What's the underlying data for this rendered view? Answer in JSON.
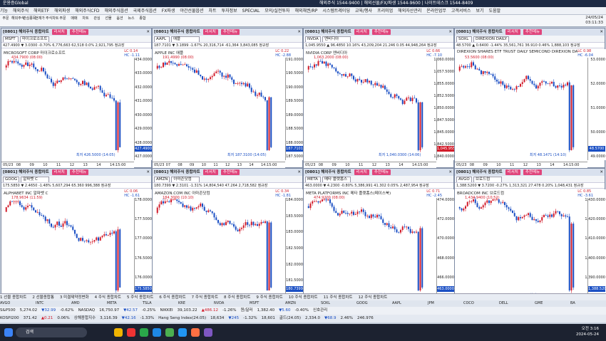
{
  "titlebar": {
    "app": "운용증Global",
    "phones": "해외주식 1544-9400 | 해외선물/FX/파생 1544-9600 | 나이트데스크 1544-8409"
  },
  "menu": [
    "기능",
    "해외주식",
    "해외ETF",
    "해외파생",
    "해외주식CFD",
    "해외주식옵션",
    "국제주식옵션",
    "FX파생",
    "야간선물옵션",
    "차트",
    "투자정보",
    "SPECIAL",
    "모의/실전투자",
    "해외채권/RP",
    "시스템트레이딩",
    "교육/행사",
    "프리미엄",
    "해외자산관리",
    "온라인업무",
    "고객서비스",
    "보기",
    "도움말"
  ],
  "toolbar": [
    "주문",
    "해외주식",
    "관심종목",
    "현재가",
    "주식차트",
    "주문",
    "매매",
    "차트",
    "관심",
    "선물",
    "옵션",
    "뉴스",
    "종합"
  ],
  "datetime": {
    "date": "24/05/24",
    "time": "03:11:33"
  },
  "panels": [
    {
      "code": "[0801] 해외주식 종합차트",
      "btn1": "리서치",
      "btn2": "추천메뉴",
      "sym": "MSFT",
      "name": "마이크로소프트",
      "r3": "427.4900 ▼ 3.0300 -0.70% 6,776,663 62,518 0.0% 2,921,795 정규장",
      "title": "MICROSOFT CORP 마이크로소프트",
      "lc": "LC 0.14",
      "hc": "HC -1.11",
      "max": "434.7900 (08:00)",
      "min": "최저 426.5000 (14:05)",
      "cur": "427.4900",
      "y": [
        "434.0000",
        "433.0000",
        "432.0000",
        "431.0000",
        "430.0000",
        "429.0000",
        "428.0000",
        "427.0000"
      ],
      "x": [
        "05/23",
        "08",
        "09",
        "10",
        "11",
        "12",
        "13",
        "14",
        "14:15:00"
      ],
      "color": "#1a4fc4"
    },
    {
      "code": "[0801] 해외주식 종합차트",
      "btn1": "리서치",
      "btn2": "추천메뉴",
      "sym": "AAPL",
      "name": "애플",
      "r3": "187.7101 ▼ 3.1899 -1.67% 20,316,714 -61,364 3,843,085 정규장",
      "title": "APPLE INC 애플",
      "lc": "LC 0.22",
      "hc": "HC -2.88",
      "max": "191.4990 (08:00)",
      "min": "최저 187.3100 (14:05)",
      "cur": "187.7101",
      "y": [
        "191.0000",
        "190.5000",
        "190.0000",
        "189.5000",
        "189.0000",
        "188.5000",
        "188.0000",
        "187.5000"
      ],
      "x": [
        "05/23",
        "07",
        "08",
        "09",
        "10",
        "11",
        "12",
        "13",
        "14",
        "14:15:00"
      ],
      "color": "#1a4fc4"
    },
    {
      "code": "[0801] 해외주식 종합차트",
      "btn1": "리서치",
      "btn2": "추천메뉴",
      "sym": "NVDA",
      "name": "엔비디아",
      "r3": "1,045.9550 ▲ 96.4850 10.16% 43,209,204 21.246 0.05 44,948,264 정규장",
      "title": "NVIDIA CORP 엔비디아",
      "lc": "LC 0.66",
      "hc": "HC -7.10",
      "max": "1,063.2000 (08:00)",
      "min": "최저 1,040.0300 (14:06)",
      "cur": "1,045.9550",
      "y": [
        "1,060.0000",
        "1,057.5000",
        "1,855.0000",
        "1,852.5000",
        "1,850.0000",
        "1,847.5000",
        "1,845.0000",
        "1,842.5000",
        "1,840.0000"
      ],
      "x": [
        "05/23",
        "08",
        "09",
        "10",
        "11",
        "12",
        "13",
        "14",
        "14:15:00"
      ],
      "color": "#d21b2a"
    },
    {
      "code": "[0801] 해외주식 종합차트",
      "btn1": "리서치",
      "btn2": "추천메뉴",
      "sym": "SOXL",
      "name": "DIREXION DAILY",
      "r3": "48.5700 ▲ 0.6400 -1.44% 35,561,761 36.910 0.46% 1,888,103 정규장",
      "title": "DIREXION SHARES ETF TRUST DAILY SEMICOND DIREXION DAILY",
      "lc": "LC 0.98",
      "hc": "HC -6.04",
      "max": "53.5600 (08:00)",
      "min": "최저 48.1471 (14:10)",
      "cur": "48.5700",
      "y": [
        "53.0000",
        "52.0000",
        "51.0000",
        "50.0000",
        "49.0000"
      ],
      "x": [
        "05/23",
        "08",
        "09",
        "10",
        "11",
        "12",
        "13",
        "14",
        "14:15:00"
      ],
      "color": "#1a4fc4"
    },
    {
      "code": "[0801] 해외주식 종합차트",
      "btn1": "리서치",
      "btn2": "추천메뉴",
      "sym": "GOOG",
      "name": "알파벳 C",
      "r3": "175.5850 ▼ 2.4650 -1.48% 5,607,294 65.360 996,388 정규장",
      "title": "ALPHABET INC 알파벳 C",
      "lc": "LC 0.06",
      "hc": "HC -1.61",
      "max": "178.9634 (11:59)",
      "min": "최저 175.3400 (14:15)",
      "cur": "175.5850",
      "y": [
        "178.0000",
        "177.5000",
        "177.0000",
        "176.5000",
        "176.0000",
        "175.5000"
      ],
      "x": [
        "05/23",
        "08",
        "09",
        "10",
        "11",
        "12",
        "13",
        "14",
        "14:15:00"
      ],
      "color": "#1a4fc4"
    },
    {
      "code": "[0801] 해외주식 종합차트",
      "btn1": "리서치",
      "btn2": "추천메뉴",
      "sym": "AMZN",
      "name": "아마존닷컴",
      "r3": "180.7399 ▼ 2.3101 -1.31% 14,804,540 47.264 2,718,582 정규장",
      "title": "AMAZON.COM INC 아마존닷컴",
      "lc": "LC 0.34",
      "hc": "HC -1.81",
      "max": "184.3000 (10:10)",
      "min": "최저 180.7200 (14:15)",
      "cur": "180.7399",
      "y": [
        "184.0000",
        "183.5000",
        "183.0000",
        "182.5000",
        "182.0000",
        "181.5000",
        "181.0000"
      ],
      "x": [
        "05/23",
        "10",
        "11",
        "12",
        "13",
        "14",
        "14:15:00"
      ],
      "color": "#1a4fc4"
    },
    {
      "code": "[0801] 해외주식 종합차트",
      "btn1": "리서치",
      "btn2": "추천메뉴",
      "sym": "META",
      "name": "메타 플랫폼스",
      "r3": "463.0000 ▼ 4.2300 -0.80% 5,386,991 41.302 0.05% 2,487,954 정규장",
      "title": "META PLATFORMS INC 메타 플랫폼스(페이스북)",
      "lc": "LC 0.71",
      "hc": "HC -2.45",
      "max": "474.9200 (08:00)",
      "min": "최저 462.6600 (14:05)",
      "cur": "463.0000",
      "y": [
        "474.0000",
        "472.0000",
        "470.0000",
        "468.0000",
        "466.0000",
        "464.0000"
      ],
      "x": [
        "05/23",
        "08",
        "09",
        "10",
        "11",
        "12",
        "13",
        "14",
        "14:15:00"
      ],
      "color": "#1a4fc4"
    },
    {
      "code": "[0801] 해외주식 종합차트",
      "btn1": "리서치",
      "btn2": "추천메뉴",
      "sym": "AVGO",
      "name": "브로드컴",
      "r3": "1,388.5200 ▼ 3.7200 -0.27% 1,313,321 27.478 0.20% 1,048,431 정규장",
      "title": "BROADCOM INC 브로드컴",
      "lc": "LC 0.85",
      "hc": "HC -3.61",
      "max": "1,434.9400 (10:52)",
      "min": "최저 1,376.2300 (10:55)",
      "cur": "1,388.5200",
      "y": [
        "1,430.0000",
        "1,420.0000",
        "1,410.0000",
        "1,400.0000",
        "1,390.0000",
        "1,380.0000"
      ],
      "x": [
        "05/23",
        "10",
        "11",
        "12",
        "13",
        "14",
        "14:15:00"
      ],
      "color": "#1a4fc4"
    }
  ],
  "chart_data": [
    {
      "type": "candlestick",
      "symbol": "MSFT",
      "ylim": [
        426.5,
        435.0
      ],
      "high": 434.79,
      "low": 426.5,
      "last": 427.49,
      "trend": "down"
    },
    {
      "type": "candlestick",
      "symbol": "AAPL",
      "ylim": [
        187.3,
        191.5
      ],
      "high": 191.499,
      "low": 187.31,
      "last": 187.7101,
      "trend": "down"
    },
    {
      "type": "candlestick",
      "symbol": "NVDA",
      "ylim": [
        1040.0,
        1063.2
      ],
      "high": 1063.2,
      "low": 1040.03,
      "last": 1045.955,
      "trend": "down"
    },
    {
      "type": "candlestick",
      "symbol": "SOXL",
      "ylim": [
        48.1,
        53.6
      ],
      "high": 53.56,
      "low": 48.1471,
      "last": 48.57,
      "trend": "down"
    },
    {
      "type": "candlestick",
      "symbol": "GOOG",
      "ylim": [
        175.3,
        179.0
      ],
      "high": 178.9634,
      "low": 175.34,
      "last": 175.585,
      "trend": "down"
    },
    {
      "type": "candlestick",
      "symbol": "AMZN",
      "ylim": [
        180.7,
        184.3
      ],
      "high": 184.3,
      "low": 180.72,
      "last": 180.7399,
      "trend": "down"
    },
    {
      "type": "candlestick",
      "symbol": "META",
      "ylim": [
        462.6,
        474.9
      ],
      "high": 474.92,
      "low": 462.66,
      "last": 463.0,
      "trend": "down"
    },
    {
      "type": "candlestick",
      "symbol": "AVGO",
      "ylim": [
        1376.0,
        1435.0
      ],
      "high": 1434.94,
      "low": 1376.23,
      "last": 1388.52,
      "trend": "down"
    }
  ],
  "bottomtabs": [
    "1 선물 종합차트",
    "2 선물종합통",
    "3 미결제약정변화",
    "4 주식 종합차트",
    "5 주식 종합차트",
    "6 주식 종합차트",
    "7 주식 종합차트",
    "8 주식 종합차트",
    "9 주식 종합차트",
    "10 주식 종합차트",
    "11 주식 종합차트",
    "12 주식 종합차트"
  ],
  "tickerhead": [
    "AVGO",
    "INTC",
    "AMD",
    "META",
    "TSLA",
    "KRE",
    "NVDA",
    "MSFT",
    "AMZN",
    "SOXL",
    "GOOG",
    "AAPL",
    "JPM",
    "COCO",
    "DELL",
    "GME",
    "BA",
    "LCID",
    "LUCD",
    "SMCI"
  ],
  "ticker1": [
    "S&P500",
    "5,274.02",
    "▼32.99",
    "-0.62%",
    "NASDAQ",
    "16,750.97",
    "▼42.57",
    "-0.25%",
    "NIKKEI",
    "39,103.22",
    "▲486.12",
    "-1.26%",
    "원/달러",
    "1,382.40",
    "▼5.60",
    "-0.40%",
    "신호관리"
  ],
  "ticker2": [
    "KOSPI200",
    "371.42",
    "▲0.21",
    "0.06%",
    "상해종합지수",
    "3,116.39",
    "▼42.16",
    "-1.33%",
    "Hang Seng Index(24.05)",
    "18,634",
    "▼245",
    "-1.32%",
    "18,601",
    "골드(24.05)",
    "2,334.0",
    "▼68.9",
    "2.46%",
    "246.976"
  ],
  "taskbar": {
    "search": "검색",
    "time": "오전 3:16",
    "date": "2024-05-24"
  }
}
